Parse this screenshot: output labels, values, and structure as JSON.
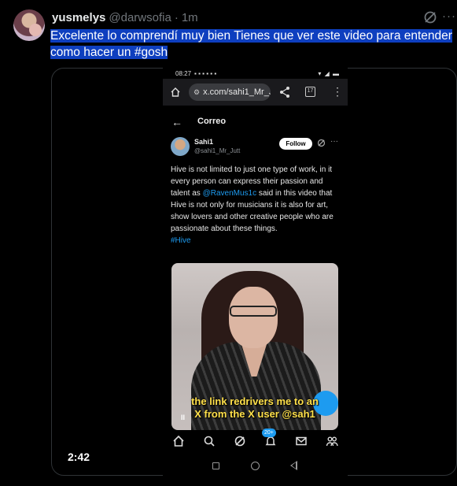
{
  "post": {
    "author_name": "yusmelys",
    "author_handle": "@darwsofia",
    "separator": "·",
    "time": "1m",
    "text_line1": "Excelente lo comprendí muy bien Tienes que ver este video para entender",
    "text_line2": "como hacer un #gosh",
    "video_duration": "2:42",
    "icons": {
      "avatar": "avatar",
      "grok": "grok-icon",
      "more": "more-icon"
    }
  },
  "recording": {
    "status_time": "08:27",
    "url": "x.com/sahi1_Mr_J",
    "tabs_count": "17",
    "nav_title": "Correo",
    "follow_label": "Follow",
    "user_name": "Sahi1",
    "user_handle": "@sahi1_Mr_Jutt",
    "body_before_mention": "Hive is not limited to just one type of work, in it every person can express their passion and talent as",
    "mention": "@RavenMus1c",
    "body_after_mention": "said in this video that Hive is not only for musicians it is also for art, show lovers and other creative people who are passionate about these things.",
    "hashtag": "#Hive",
    "caption_line1": "the link redrivers me to an",
    "caption_line2": "X from the X user @sah1",
    "notification_badge": "20+",
    "accent_color": "#1d9bf0"
  }
}
